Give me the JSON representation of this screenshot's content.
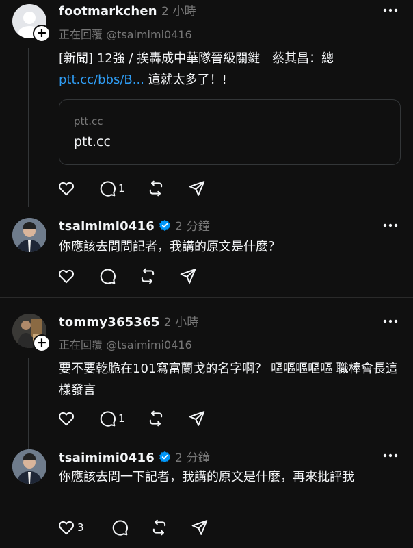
{
  "posts": [
    {
      "username": "footmarkchen",
      "time": "2 小時",
      "reply_to": "正在回覆 @tsaimimi0416",
      "text_line1": "[新聞] 12強 / 挨轟成中華隊晉級關鍵　蔡其昌：總",
      "link_text": "ptt.cc/bbs/B...",
      "text_line2_rest": " 這就太多了！!",
      "card": {
        "domain": "ptt.cc",
        "title": "ptt.cc"
      },
      "reply_count": "1"
    },
    {
      "username": "tsaimimi0416",
      "time": "2 分鐘",
      "text": "你應該去問問記者，我講的原文是什麼？"
    },
    {
      "username": "tommy365365",
      "time": "2 小時",
      "reply_to": "正在回覆 @tsaimimi0416",
      "text": "要不要乾脆在101寫富蘭戈的名字啊？ 嘔嘔嘔嘔嘔 職棒會長這樣發言",
      "reply_count": "1"
    },
    {
      "username": "tsaimimi0416",
      "time": "2 分鐘",
      "text": "你應該去問一下記者，我講的原文是什麼，再來批評我",
      "like_count": "3"
    }
  ],
  "icons": [
    "heart-icon",
    "comment-icon",
    "repost-icon",
    "share-icon",
    "more-icon",
    "verified-icon",
    "follow-plus-icon"
  ],
  "colors": {
    "background": "#101010",
    "link": "#2f9df4",
    "verified": "#0095f6",
    "secondary_text": "#777777"
  }
}
